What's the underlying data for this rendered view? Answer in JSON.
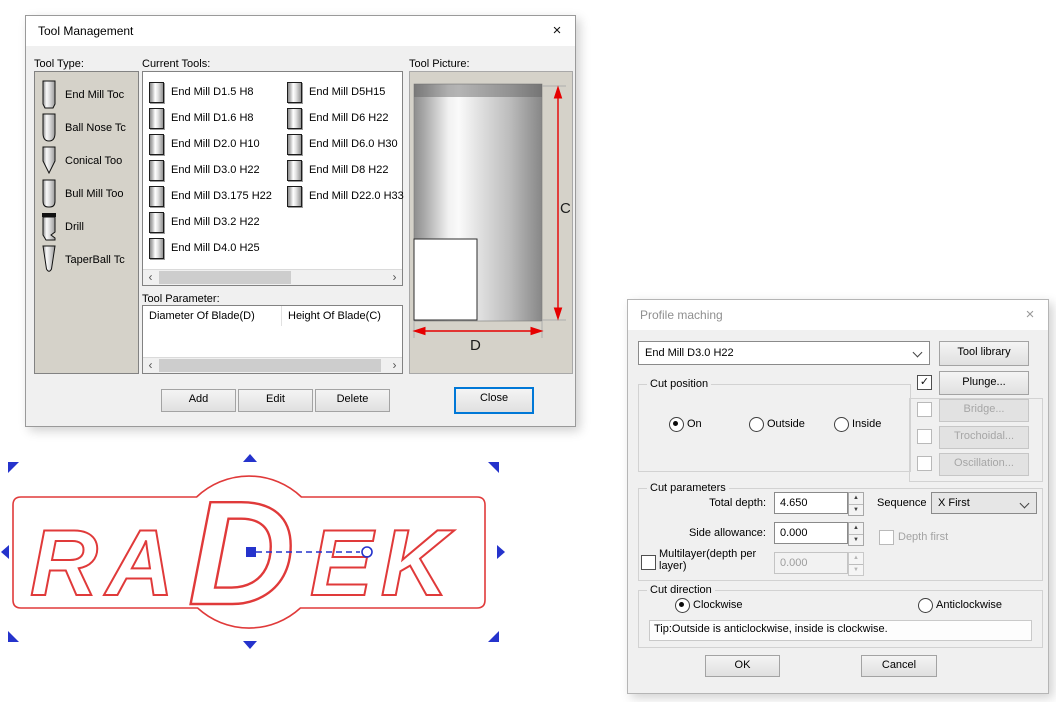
{
  "tool_management": {
    "title": "Tool Management",
    "labels": {
      "tool_type": "Tool Type:",
      "current_tools": "Current Tools:",
      "tool_parameter": "Tool Parameter:",
      "tool_picture": "Tool Picture:"
    },
    "tool_types": [
      "End Mill Toc",
      "Ball Nose Tc",
      "Conical Too",
      "Bull Mill Too",
      "Drill",
      "TaperBall Tc"
    ],
    "current_tools": {
      "col1": [
        "End Mill D1.5 H8",
        "End Mill D1.6 H8",
        "End Mill D2.0 H10",
        "End Mill D3.0 H22",
        "End Mill D3.175 H22",
        "End Mill D3.2 H22",
        "End Mill D4.0 H25"
      ],
      "col2": [
        "End Mill D5H15",
        "End Mill D6 H22",
        "End Mill D6.0 H30",
        "End Mill D8 H22",
        "End Mill D22.0 H33"
      ]
    },
    "param_columns": [
      "Diameter Of Blade(D)",
      "Height Of Blade(C)"
    ],
    "buttons": {
      "add": "Add",
      "edit": "Edit",
      "delete": "Delete",
      "close": "Close"
    },
    "picture": {
      "dim_vertical": "C",
      "dim_horizontal": "D"
    }
  },
  "profile_maching": {
    "title": "Profile maching",
    "tool_select_value": "End Mill D3.0 H22",
    "tool_library_label": "Tool library",
    "aux_buttons": {
      "plunge": "Plunge...",
      "bridge": "Bridge...",
      "trochoidal": "Trochoidal...",
      "oscillation": "Oscillation..."
    },
    "cut_position": {
      "legend": "Cut position",
      "on": "On",
      "outside": "Outside",
      "inside": "Inside",
      "selected": "On"
    },
    "cut_parameters": {
      "legend": "Cut parameters",
      "total_depth_label": "Total depth:",
      "total_depth_value": "4.650",
      "sequence_label": "Sequence",
      "sequence_value": "X First",
      "side_allowance_label": "Side allowance:",
      "side_allowance_value": "0.000",
      "depth_first_label": "Depth first",
      "multilayer_label": "Multilayer(depth per layer)",
      "multilayer_value": "0.000"
    },
    "cut_direction": {
      "legend": "Cut direction",
      "clockwise": "Clockwise",
      "anticlockwise": "Anticlockwise",
      "selected": "Clockwise",
      "tip": "Tip:Outside is anticlockwise, inside is clockwise."
    },
    "buttons": {
      "ok": "OK",
      "cancel": "Cancel"
    }
  },
  "canvas": {
    "logo": {
      "ra": "RA",
      "d": "D",
      "ek": "EK"
    }
  },
  "icons": {
    "close": "×",
    "scroll_left": "‹",
    "scroll_right": "›",
    "check": "✓",
    "spin_up": "▲",
    "spin_down": "▼"
  },
  "colors": {
    "accent_blue": "#0078d7",
    "logo_red": "#e03a3a",
    "handle_blue": "#2533cc",
    "dimension_red": "#e60000",
    "panel_beige": "#d5d2c9"
  }
}
